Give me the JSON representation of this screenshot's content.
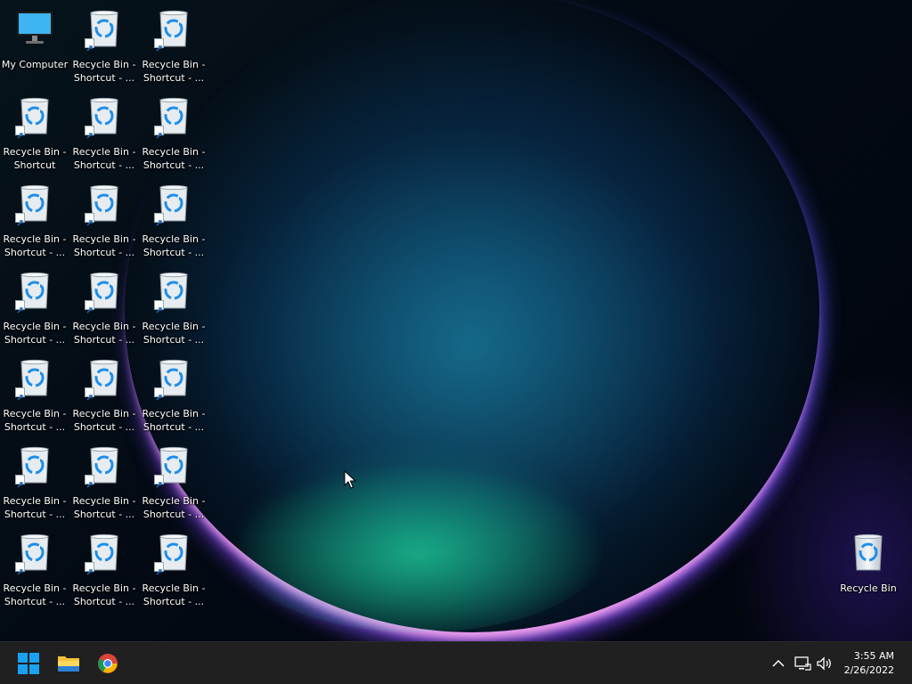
{
  "desktop": {
    "icons": [
      {
        "label": "My Computer",
        "type": "computer"
      },
      {
        "label": "Recycle Bin -\nShortcut - ...",
        "type": "recycle-shortcut"
      },
      {
        "label": "Recycle Bin -\nShortcut - ...",
        "type": "recycle-shortcut"
      },
      {
        "label": "Recycle Bin -\nShortcut",
        "type": "recycle-shortcut"
      },
      {
        "label": "Recycle Bin -\nShortcut - ...",
        "type": "recycle-shortcut"
      },
      {
        "label": "Recycle Bin -\nShortcut - ...",
        "type": "recycle-shortcut"
      },
      {
        "label": "Recycle Bin -\nShortcut - ...",
        "type": "recycle-shortcut"
      },
      {
        "label": "Recycle Bin -\nShortcut - ...",
        "type": "recycle-shortcut"
      },
      {
        "label": "Recycle Bin -\nShortcut - ...",
        "type": "recycle-shortcut"
      },
      {
        "label": "Recycle Bin -\nShortcut - ...",
        "type": "recycle-shortcut"
      },
      {
        "label": "Recycle Bin -\nShortcut - ...",
        "type": "recycle-shortcut"
      },
      {
        "label": "Recycle Bin -\nShortcut - ...",
        "type": "recycle-shortcut"
      },
      {
        "label": "Recycle Bin -\nShortcut - ...",
        "type": "recycle-shortcut"
      },
      {
        "label": "Recycle Bin -\nShortcut - ...",
        "type": "recycle-shortcut"
      },
      {
        "label": "Recycle Bin -\nShortcut - ...",
        "type": "recycle-shortcut"
      },
      {
        "label": "Recycle Bin -\nShortcut - ...",
        "type": "recycle-shortcut"
      },
      {
        "label": "Recycle Bin -\nShortcut - ...",
        "type": "recycle-shortcut"
      },
      {
        "label": "Recycle Bin -\nShortcut - ...",
        "type": "recycle-shortcut"
      },
      {
        "label": "Recycle Bin -\nShortcut - ...",
        "type": "recycle-shortcut"
      },
      {
        "label": "Recycle Bin -\nShortcut - ...",
        "type": "recycle-shortcut"
      },
      {
        "label": "Recycle Bin -\nShortcut - ...",
        "type": "recycle-shortcut"
      }
    ],
    "recycle_bin": {
      "label": "Recycle Bin"
    }
  },
  "taskbar": {
    "pinned": [
      {
        "name": "start",
        "icon": "windows-logo-icon"
      },
      {
        "name": "file-explorer",
        "icon": "folder-icon"
      },
      {
        "name": "chrome",
        "icon": "chrome-icon"
      }
    ],
    "tray": {
      "icons": [
        "chevron-up-icon",
        "network-icon",
        "volume-icon"
      ],
      "time": "3:55 AM",
      "date": "2/26/2022"
    }
  },
  "colors": {
    "taskbar_bg": "#202020",
    "accent": "#0078d4"
  }
}
